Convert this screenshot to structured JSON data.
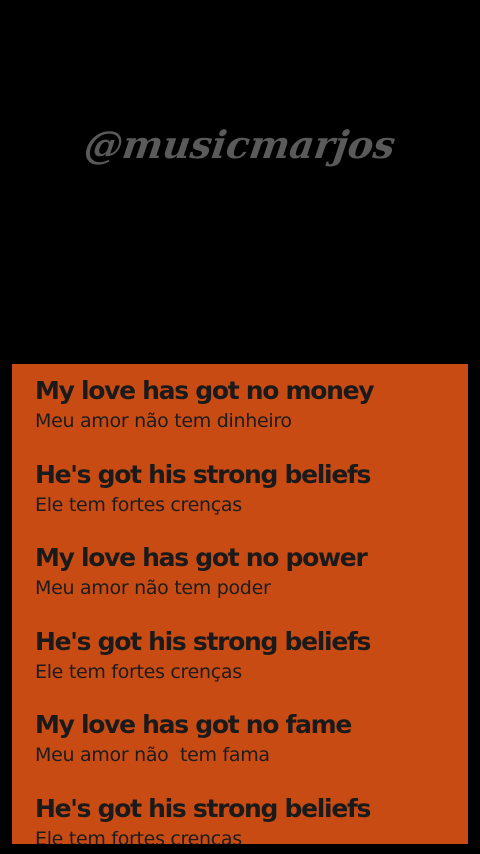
{
  "watermark": {
    "text": "@musicmarjos"
  },
  "lyrics": {
    "lines": [
      {
        "original": "My love has got no money",
        "translation": "Meu amor não tem dinheiro"
      },
      {
        "original": "He's got his strong beliefs",
        "translation": "Ele tem fortes crenças"
      },
      {
        "original": "My love has got no power",
        "translation": "Meu amor não tem poder"
      },
      {
        "original": "He's got his strong beliefs",
        "translation": "Ele tem fortes crenças"
      },
      {
        "original": "My love has got no fame",
        "translation": "Meu amor não  tem fama"
      },
      {
        "original": "He's got his strong beliefs",
        "translation": "Ele tem fortes crenças"
      }
    ]
  },
  "colors": {
    "background": "#000000",
    "card": "#c94b14",
    "text": "#1a1a1a",
    "watermark": "#5a5a5a"
  }
}
